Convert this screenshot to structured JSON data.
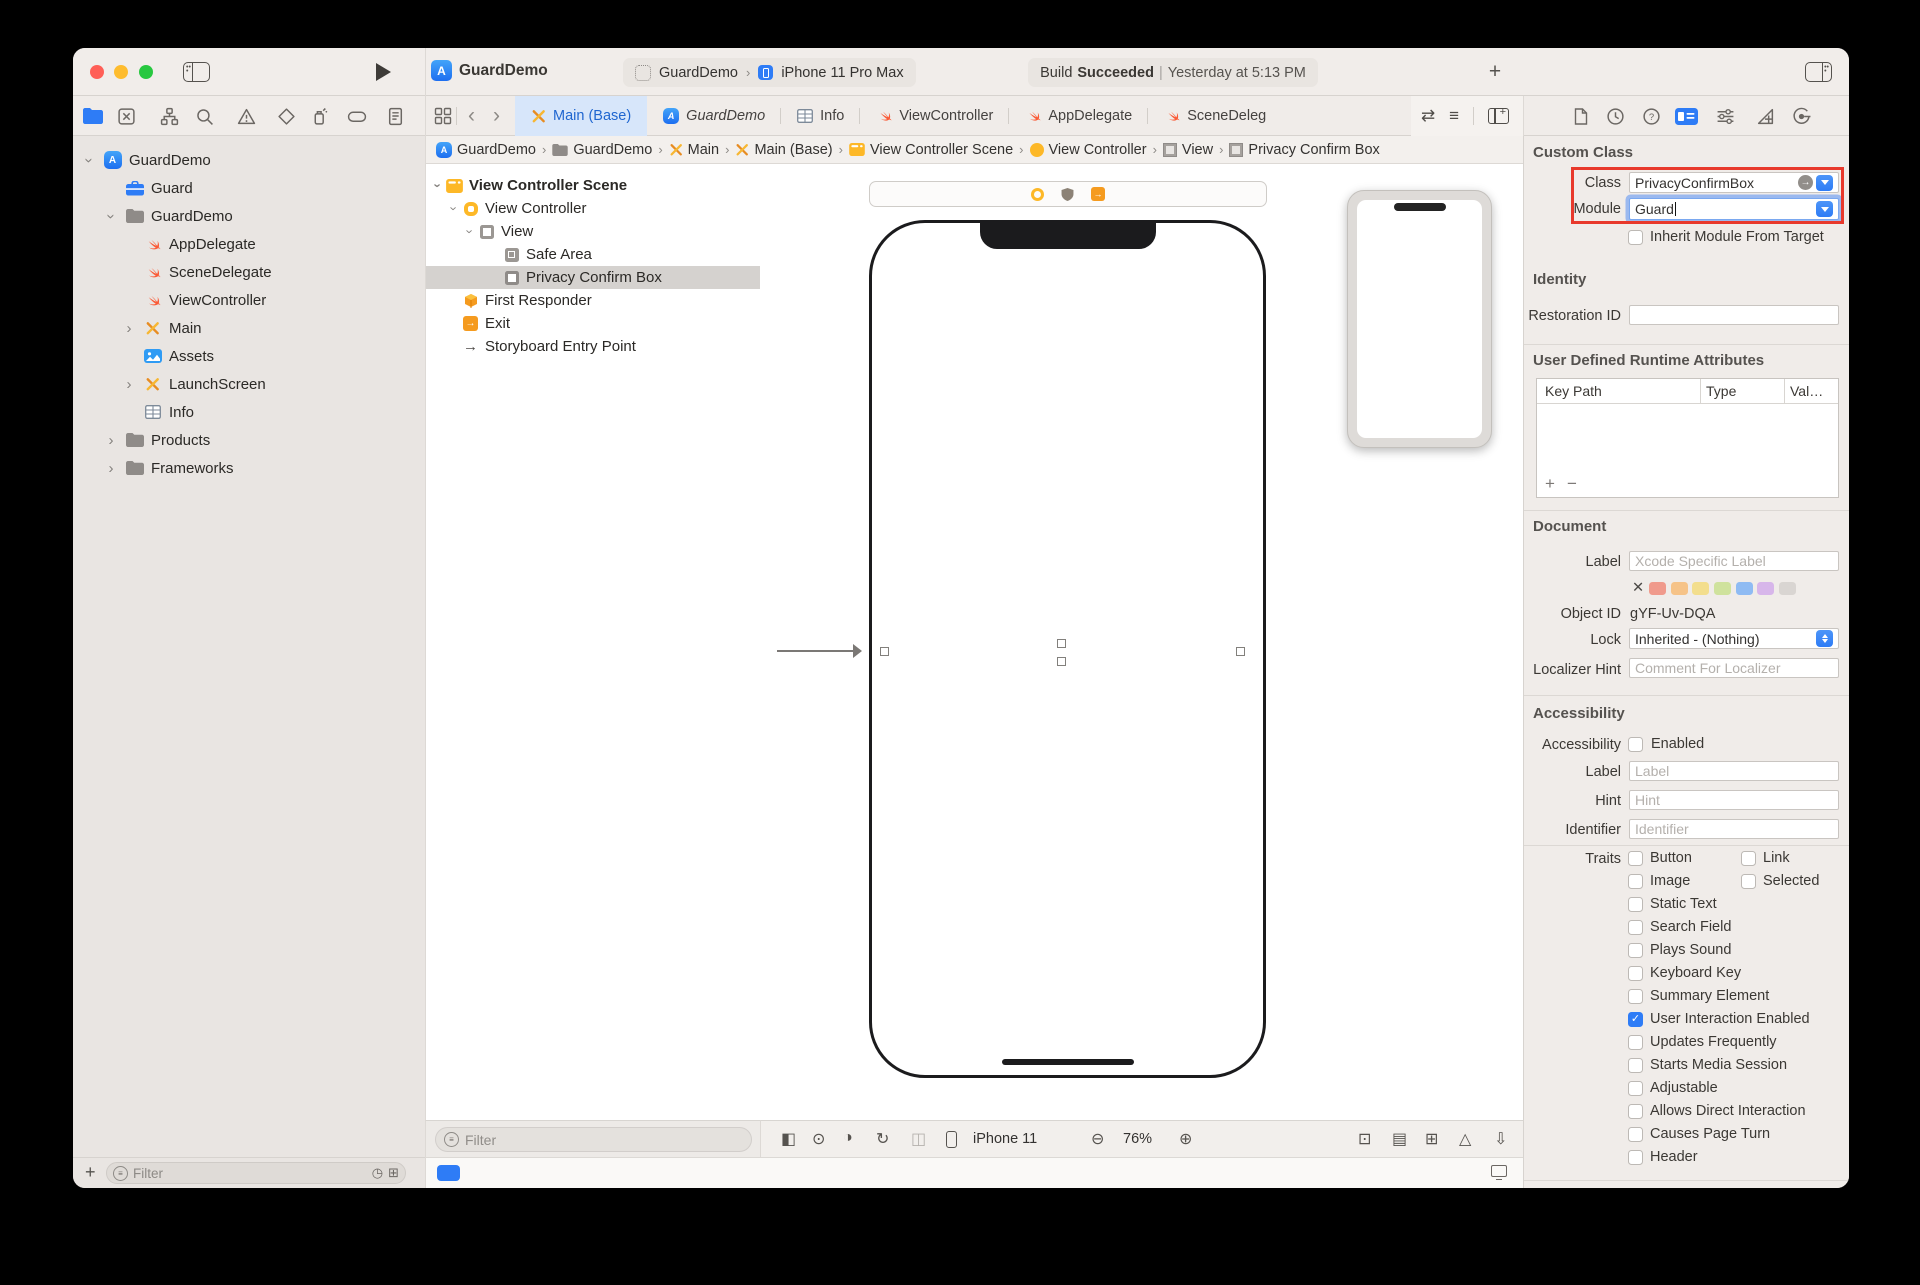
{
  "toolbar": {
    "title": "GuardDemo",
    "scheme_target": "GuardDemo",
    "scheme_destination": "iPhone 11 Pro Max",
    "status_action": "Build",
    "status_result": "Succeeded",
    "status_separator": "|",
    "status_time": "Yesterday at 5:13 PM",
    "add_button": "+"
  },
  "navigator": {
    "items": [
      {
        "label": "GuardDemo"
      },
      {
        "label": "Guard"
      },
      {
        "label": "GuardDemo"
      },
      {
        "label": "AppDelegate"
      },
      {
        "label": "SceneDelegate"
      },
      {
        "label": "ViewController"
      },
      {
        "label": "Main"
      },
      {
        "label": "Assets"
      },
      {
        "label": "LaunchScreen"
      },
      {
        "label": "Info"
      },
      {
        "label": "Products"
      },
      {
        "label": "Frameworks"
      }
    ],
    "filter_placeholder": "Filter"
  },
  "tabs": {
    "tab0": "Main (Base)",
    "tab1": "GuardDemo",
    "tab2": "Info",
    "tab3": "ViewController",
    "tab4": "AppDelegate",
    "tab5": "SceneDeleg"
  },
  "breadcrumbs": {
    "b0": "GuardDemo",
    "b1": "GuardDemo",
    "b2": "Main",
    "b3": "Main (Base)",
    "b4": "View Controller Scene",
    "b5": "View Controller",
    "b6": "View",
    "b7": "Privacy Confirm Box"
  },
  "outline": {
    "r0": "View Controller Scene",
    "r1": "View Controller",
    "r2": "View",
    "r3": "Safe Area",
    "r4": "Privacy Confirm Box",
    "r5": "First Responder",
    "r6": "Exit",
    "r7": "Storyboard Entry Point",
    "filter_placeholder": "Filter"
  },
  "canvas": {
    "device": "iPhone 11",
    "zoom": "76%"
  },
  "inspector": {
    "custom_class": {
      "header": "Custom Class",
      "class_label": "Class",
      "class_value": "PrivacyConfirmBox",
      "module_label": "Module",
      "module_value": "Guard",
      "inherit_label": "Inherit Module From Target"
    },
    "identity": {
      "header": "Identity",
      "restoration_label": "Restoration ID"
    },
    "runtime_attributes": {
      "header": "User Defined Runtime Attributes",
      "col_key_path": "Key Path",
      "col_type": "Type",
      "col_value": "Val…",
      "add": "+",
      "remove": "−"
    },
    "document": {
      "header": "Document",
      "label_label": "Label",
      "label_placeholder": "Xcode Specific Label",
      "object_id_label": "Object ID",
      "object_id_value": "gYF-Uv-DQA",
      "lock_label": "Lock",
      "lock_value": "Inherited - (Nothing)",
      "localizer_label": "Localizer Hint",
      "localizer_placeholder": "Comment For Localizer"
    },
    "accessibility": {
      "header": "Accessibility",
      "accessibility_label": "Accessibility",
      "enabled_label": "Enabled",
      "label_label": "Label",
      "label_placeholder": "Label",
      "hint_label": "Hint",
      "hint_placeholder": "Hint",
      "identifier_label": "Identifier",
      "identifier_placeholder": "Identifier",
      "traits_label": "Traits",
      "traits": {
        "t0": "Button",
        "t1": "Link",
        "t2": "Image",
        "t3": "Selected",
        "t4": "Static Text",
        "t5": "Search Field",
        "t6": "Plays Sound",
        "t7": "Keyboard Key",
        "t8": "Summary Element",
        "t9": "User Interaction Enabled",
        "t10": "Updates Frequently",
        "t11": "Starts Media Session",
        "t12": "Adjustable",
        "t13": "Allows Direct Interaction",
        "t14": "Causes Page Turn",
        "t15": "Header"
      }
    }
  },
  "colors": {
    "accent_blue": "#2e7cf6",
    "highlight_red": "#e8392c",
    "swift_orange": "#fa5b37",
    "storyboard_yellow": "#fdb827"
  }
}
